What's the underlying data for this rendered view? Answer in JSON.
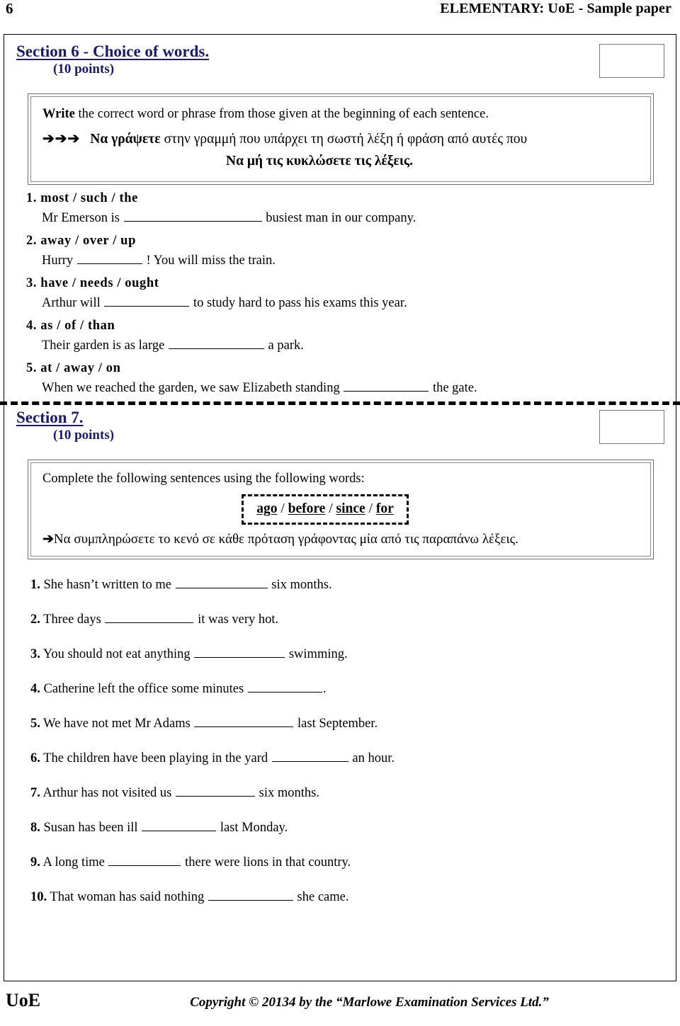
{
  "header": {
    "page_number": "6",
    "title": "ELEMENTARY: UoE - Sample paper"
  },
  "colors": {
    "section_heading": "#1a1a6e",
    "rule": "#000000",
    "box_border": "#6f6f6f"
  },
  "section6": {
    "heading": "Section 6 - Choice of words.",
    "points": "(10 points)",
    "score_box_value": "",
    "instructions": {
      "english_bold": "Write",
      "english_rest": " the correct word or phrase from those given at the beginning of each sentence.",
      "arrows_icon": "➔➔➔",
      "greek_bold": "Να γράψετε",
      "greek_rest": " στην γραμμή που υπάρχει τη σωστή λέξη ή φράση από αυτές που",
      "greek_line2": "Να μή τις κυκλώσετε τις λέξεις."
    },
    "items": [
      {
        "num": "1.",
        "choices": "most  /  such  /  the",
        "before": "Mr Emerson is",
        "blank_width": 195,
        "after": "busiest man in our company."
      },
      {
        "num": "2.",
        "choices": "away  /  over  /  up",
        "before": "Hurry",
        "blank_width": 92,
        "after": "!  You will miss the train."
      },
      {
        "num": "3.",
        "choices": "have  /  needs  /  ought",
        "before": "Arthur will",
        "blank_width": 120,
        "after": "to study hard to pass his exams this year."
      },
      {
        "num": "4.",
        "choices": "as  /  of  /  than",
        "before": "Their garden is as large",
        "blank_width": 135,
        "after": "a park."
      },
      {
        "num": "5.",
        "choices": "at  /  away  /  on",
        "before": "When we reached the garden, we saw Elizabeth standing",
        "blank_width": 120,
        "after": "the gate."
      }
    ]
  },
  "section7": {
    "heading": "Section  7.",
    "points": "(10 points)",
    "score_box_value": "",
    "instructions": {
      "english": "Complete the following sentences using the following words:",
      "word_bank": [
        "ago",
        "before",
        "since",
        "for"
      ],
      "word_bank_separator": "/",
      "arrow_icon": "➔",
      "greek": "Να συμπληρώσετε το κενό σε κάθε πρόταση γράφοντας μία από τις παραπάνω λέξεις."
    },
    "items": [
      {
        "num": "1.",
        "before": "She hasn’t written to me",
        "blank_width": 130,
        "after": "six months."
      },
      {
        "num": "2.",
        "before": "Three days",
        "blank_width": 125,
        "after": "it was very hot."
      },
      {
        "num": "3.",
        "before": "You should not eat anything",
        "blank_width": 128,
        "after": "swimming."
      },
      {
        "num": "4.",
        "before": "Catherine left the office some minutes",
        "blank_width": 105,
        "after": "."
      },
      {
        "num": "5.",
        "before": "We have not met Mr Adams",
        "blank_width": 140,
        "after": "last September."
      },
      {
        "num": "6.",
        "before": "The children have been playing in the yard",
        "blank_width": 108,
        "after": "an hour."
      },
      {
        "num": "7.",
        "before": "Arthur has not visited us",
        "blank_width": 112,
        "after": "six months."
      },
      {
        "num": "8.",
        "before": "Susan has been ill",
        "blank_width": 105,
        "after": "last Monday."
      },
      {
        "num": "9.",
        "before": "A long time",
        "blank_width": 102,
        "after": "there were lions in that country."
      },
      {
        "num": "10.",
        "before": "That woman has said nothing",
        "blank_width": 120,
        "after": "she came."
      }
    ]
  },
  "footer": {
    "brand": "UoE",
    "copyright": "Copyright © 20134 by the “Marlowe Examination Services Ltd.”"
  }
}
